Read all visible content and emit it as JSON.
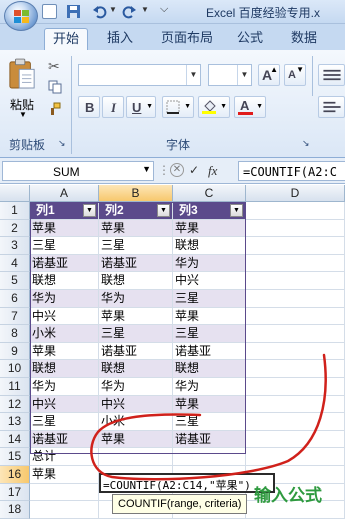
{
  "title_bar": {
    "title": "Excel 百度经验专用.x"
  },
  "ribbon": {
    "tabs": [
      {
        "label": "开始",
        "active": true
      },
      {
        "label": "插入",
        "active": false
      },
      {
        "label": "页面布局",
        "active": false
      },
      {
        "label": "公式",
        "active": false
      },
      {
        "label": "数据",
        "active": false
      }
    ],
    "clipboard": {
      "paste_label": "粘贴",
      "group_label": "剪贴板"
    },
    "font": {
      "group_label": "字体",
      "bold": "B",
      "italic": "I",
      "underline": "U",
      "grow": "A",
      "shrink": "A",
      "font_color_glyph": "A"
    }
  },
  "formula_bar": {
    "name_box": "SUM",
    "fx": "fx",
    "formula": "=COUNTIF(A2:C"
  },
  "grid": {
    "columns": [
      "A",
      "B",
      "C",
      "D"
    ],
    "table_headers": [
      "列1",
      "列2",
      "列3"
    ],
    "rows": [
      {
        "n": "1"
      },
      {
        "n": "2",
        "cells": [
          "苹果",
          "苹果",
          "苹果"
        ]
      },
      {
        "n": "3",
        "cells": [
          "三星",
          "三星",
          "联想"
        ]
      },
      {
        "n": "4",
        "cells": [
          "诺基亚",
          "诺基亚",
          "华为"
        ]
      },
      {
        "n": "5",
        "cells": [
          "联想",
          "联想",
          "中兴"
        ]
      },
      {
        "n": "6",
        "cells": [
          "华为",
          "华为",
          "三星"
        ]
      },
      {
        "n": "7",
        "cells": [
          "中兴",
          "苹果",
          "苹果"
        ]
      },
      {
        "n": "8",
        "cells": [
          "小米",
          "三星",
          "三星"
        ]
      },
      {
        "n": "9",
        "cells": [
          "苹果",
          "诺基亚",
          "诺基亚"
        ]
      },
      {
        "n": "10",
        "cells": [
          "联想",
          "联想",
          "联想"
        ]
      },
      {
        "n": "11",
        "cells": [
          "华为",
          "华为",
          "华为"
        ]
      },
      {
        "n": "12",
        "cells": [
          "中兴",
          "中兴",
          "苹果"
        ]
      },
      {
        "n": "13",
        "cells": [
          "三星",
          "小米",
          "三星"
        ]
      },
      {
        "n": "14",
        "cells": [
          "诺基亚",
          "苹果",
          "诺基亚"
        ]
      },
      {
        "n": "15",
        "cells": [
          "总计",
          "",
          ""
        ]
      },
      {
        "n": "16",
        "cells": [
          "苹果",
          "",
          ""
        ]
      },
      {
        "n": "17"
      },
      {
        "n": "18"
      }
    ],
    "editing_cell": "=COUNTIF(A2:C14,\"苹果\")",
    "tooltip": "COUNTIF(range, criteria)"
  },
  "annotation": "输入公式",
  "colors": {
    "table_header": "#5b4a8b",
    "table_band": "#e6e1f0",
    "annotation": "#2f9a3f",
    "ink_circle": "#d0211b"
  }
}
